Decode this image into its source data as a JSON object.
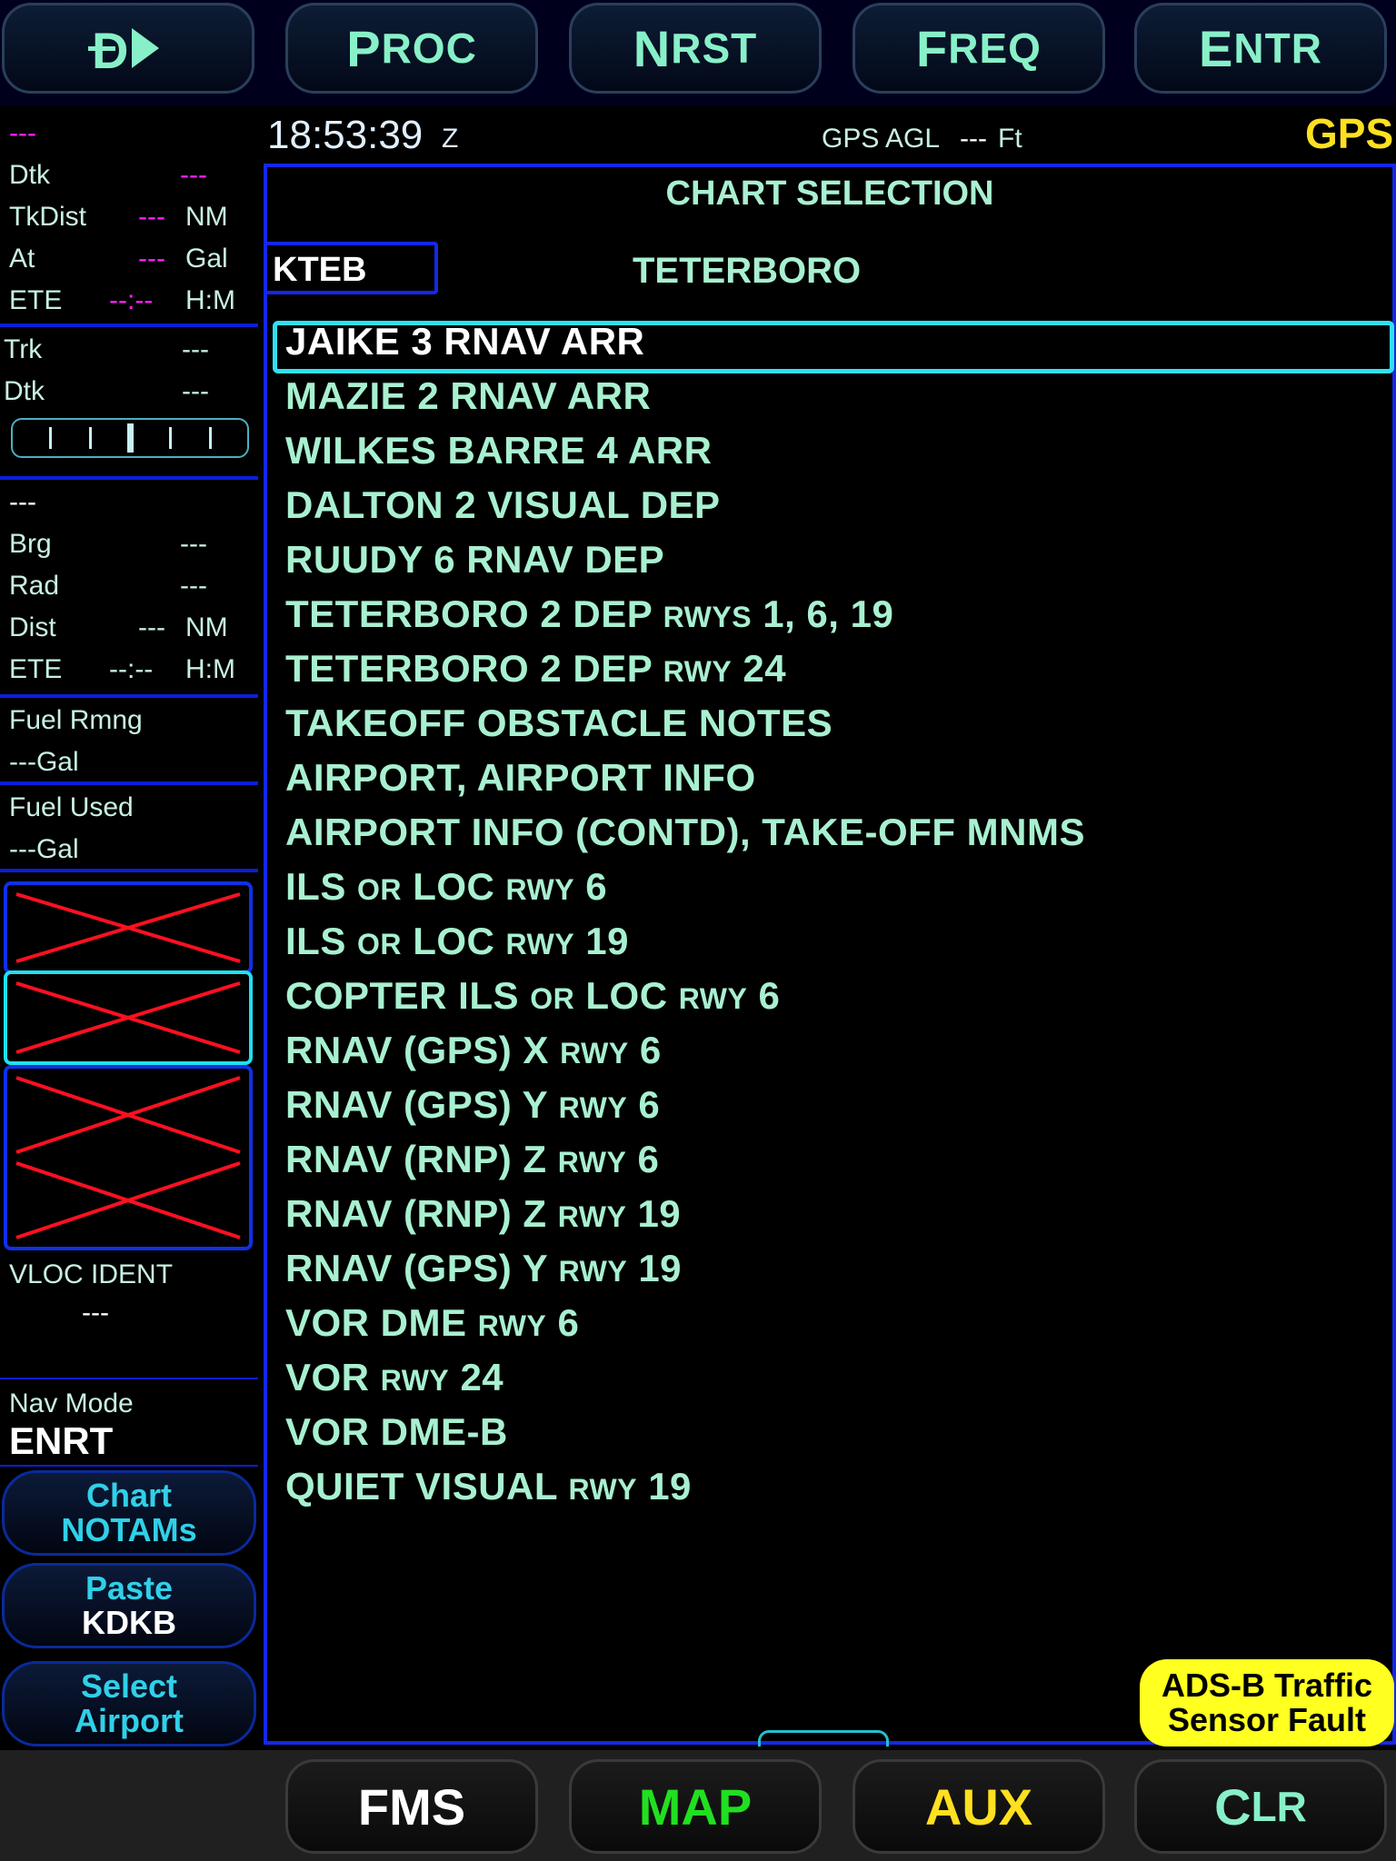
{
  "top_buttons": {
    "direct_to": "D",
    "proc": {
      "first": "P",
      "rest": "ROC"
    },
    "nrst": {
      "first": "N",
      "rest": "RST"
    },
    "freq": {
      "first": "F",
      "rest": "REQ"
    },
    "entr": {
      "first": "E",
      "rest": "NTR"
    }
  },
  "status": {
    "time": "18:53:39",
    "time_zone": "Z",
    "agl_label": "GPS AGL",
    "agl_value": "---",
    "agl_unit": "Ft",
    "source": "GPS"
  },
  "left_panel": {
    "wpt_value": "---",
    "dtk_label": "Dtk",
    "dtk_value": "---",
    "tkdist_label": "TkDist",
    "tkdist_value": "---",
    "tkdist_unit": "NM",
    "at_label": "At",
    "at_value": "---",
    "at_unit": "Gal",
    "ete1_label": "ETE",
    "ete1_value": "--:--",
    "ete1_unit": "H:M",
    "trk_label": "Trk",
    "trk_value": "---",
    "dtk2_label": "Dtk",
    "dtk2_value": "---",
    "nav2_value": "---",
    "brg_label": "Brg",
    "brg_value": "---",
    "rad_label": "Rad",
    "rad_value": "---",
    "dist_label": "Dist",
    "dist_value": "---",
    "dist_unit": "NM",
    "ete2_label": "ETE",
    "ete2_value": "--:--",
    "ete2_unit": "H:M",
    "fuel_rmng_label": "Fuel Rmng",
    "fuel_rmng_value": "---Gal",
    "fuel_used_label": "Fuel Used",
    "fuel_used_value": "---Gal",
    "vloc_label": "VLOC IDENT",
    "vloc_value": "---",
    "nav_mode_label": "Nav Mode",
    "nav_mode_value": "ENRT",
    "chart_notams": {
      "line1": "Chart",
      "line2": "NOTAMs"
    },
    "paste": {
      "line1": "Paste",
      "line2": "KDKB"
    },
    "select_airport": {
      "line1": "Select",
      "line2": "Airport"
    }
  },
  "chart_selection": {
    "title": "CHART SELECTION",
    "airport_id": "KTEB",
    "airport_name": "TETERBORO",
    "selected_index": 0,
    "items": [
      {
        "main": "JAIKE 3 RNAV ARR"
      },
      {
        "main": "MAZIE 2 RNAV ARR"
      },
      {
        "main": "WILKES BARRE 4 ARR"
      },
      {
        "main": "DALTON 2 VISUAL DEP"
      },
      {
        "main": "RUUDY 6 RNAV DEP"
      },
      {
        "main": "TETERBORO 2 DEP",
        "sc": "RWYS",
        "tail": "1, 6, 19"
      },
      {
        "main": "TETERBORO 2 DEP",
        "sc": "RWY",
        "tail": "24"
      },
      {
        "main": "TAKEOFF OBSTACLE NOTES"
      },
      {
        "main": "AIRPORT, AIRPORT INFO"
      },
      {
        "main": "AIRPORT INFO (CONTD), TAKE-OFF MNMS"
      },
      {
        "main": "ILS",
        "sc": "OR",
        "tail": "LOC",
        "sc2": "RWY",
        "tail2": "6"
      },
      {
        "main": "ILS",
        "sc": "OR",
        "tail": "LOC",
        "sc2": "RWY",
        "tail2": "19"
      },
      {
        "main": "COPTER ILS",
        "sc": "OR",
        "tail": "LOC",
        "sc2": "RWY",
        "tail2": "6"
      },
      {
        "main": "RNAV (GPS) X",
        "sc": "RWY",
        "tail": "6"
      },
      {
        "main": "RNAV (GPS) Y",
        "sc": "RWY",
        "tail": "6"
      },
      {
        "main": "RNAV (RNP) Z",
        "sc": "RWY",
        "tail": "6"
      },
      {
        "main": "RNAV (RNP) Z",
        "sc": "RWY",
        "tail": "19"
      },
      {
        "main": "RNAV (GPS) Y",
        "sc": "RWY",
        "tail": "19"
      },
      {
        "main": "VOR DME",
        "sc": "RWY",
        "tail": "6"
      },
      {
        "main": "VOR",
        "sc": "RWY",
        "tail": "24"
      },
      {
        "main": "VOR DME-B"
      },
      {
        "main": "QUIET VISUAL",
        "sc": "RWY",
        "tail": "19"
      }
    ]
  },
  "alert": {
    "line1": "ADS-B Traffic",
    "line2": "Sensor Fault"
  },
  "bottom_buttons": {
    "fms": "FMS",
    "map": "MAP",
    "aux": "AUX",
    "clr": {
      "first": "C",
      "rest": "LR"
    }
  },
  "colors": {
    "accent": "#30e0f0",
    "frame": "#1428e8",
    "magenta": "#ff20ff",
    "text": "#a8f0d0",
    "alert": "#ffff20"
  }
}
